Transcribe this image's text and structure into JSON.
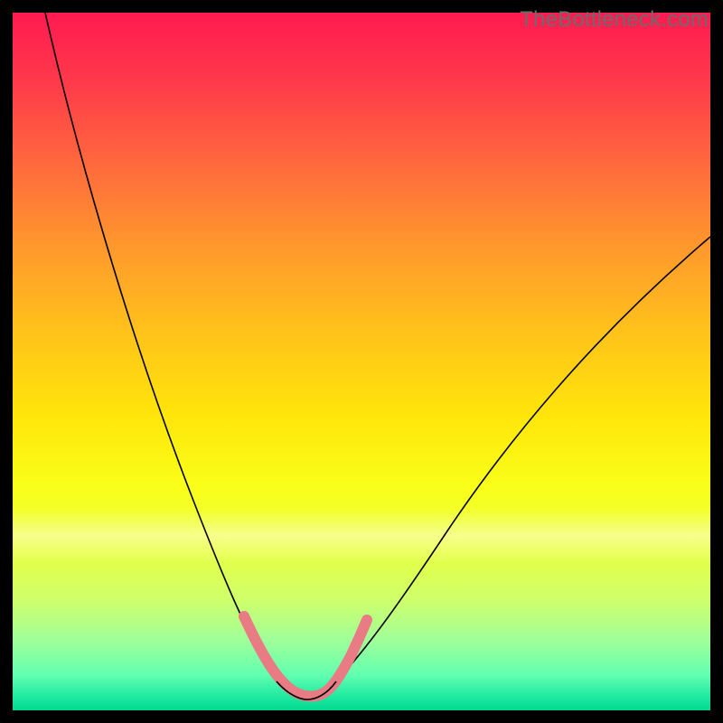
{
  "watermark": {
    "text": "TheBottleneck.com"
  },
  "chart_data": {
    "type": "line",
    "title": "",
    "xlabel": "",
    "ylabel": "",
    "xlim": [
      0,
      100
    ],
    "ylim": [
      0,
      100
    ],
    "grid": false,
    "legend": false,
    "series": [
      {
        "name": "bottleneck-curve",
        "x": [
          4,
          8,
          12,
          16,
          20,
          24,
          28,
          32,
          34,
          36,
          38,
          40,
          42,
          44,
          48,
          52,
          56,
          60,
          66,
          74,
          82,
          90,
          100
        ],
        "values": [
          100,
          88,
          76,
          65,
          54,
          43,
          32,
          21,
          15,
          10,
          6,
          3,
          2,
          3,
          6,
          12,
          18,
          25,
          34,
          45,
          55,
          62,
          70
        ]
      },
      {
        "name": "optimal-range-highlight",
        "x": [
          32,
          34,
          36,
          38,
          40,
          42,
          44,
          46,
          48
        ],
        "values": [
          16,
          9,
          5,
          3,
          2,
          2,
          3,
          5,
          9
        ]
      }
    ],
    "background": {
      "type": "vertical-gradient",
      "stops": [
        {
          "pos": 0.0,
          "color": "#ff1a51"
        },
        {
          "pos": 0.5,
          "color": "#ffd500"
        },
        {
          "pos": 0.8,
          "color": "#eaff3a"
        },
        {
          "pos": 1.0,
          "color": "#00d890"
        }
      ]
    }
  }
}
